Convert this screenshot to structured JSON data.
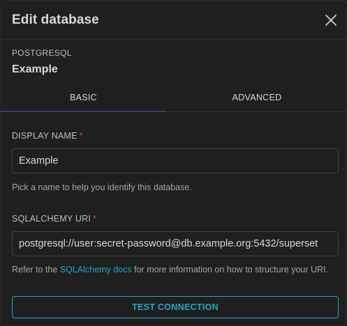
{
  "modal": {
    "title": "Edit database"
  },
  "database": {
    "type": "POSTGRESQL",
    "name": "Example"
  },
  "tabs": [
    {
      "label": "BASIC",
      "active": true
    },
    {
      "label": "ADVANCED",
      "active": false
    }
  ],
  "display_name": {
    "label": "DISPLAY NAME",
    "required_mark": "*",
    "value": "Example",
    "helper": "Pick a name to help you identify this database."
  },
  "sqlalchemy_uri": {
    "label": "SQLALCHEMY URI",
    "required_mark": "*",
    "value": "postgresql://user:secret-password@db.example.org:5432/superset",
    "helper_prefix": "Refer to the ",
    "helper_link": "SQLAlchemy docs",
    "helper_suffix": " for more information on how to structure your URI."
  },
  "actions": {
    "test_connection": "TEST CONNECTION"
  },
  "icons": {
    "close": "close-icon"
  },
  "colors": {
    "accent": "#20a7c9",
    "required": "#e04355",
    "tab_underline": "#3c3c6b",
    "background": "#1f1f1f"
  }
}
